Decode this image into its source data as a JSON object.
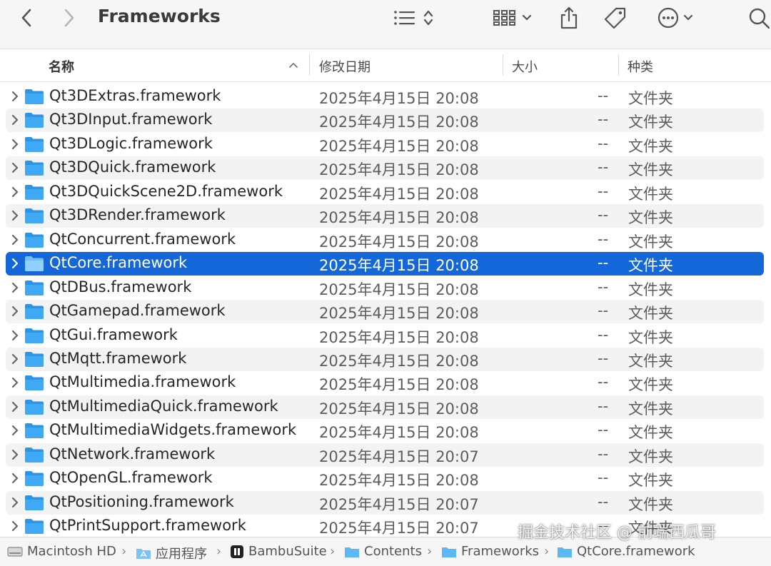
{
  "toolbar": {
    "title": "Frameworks",
    "back_icon": "chevron-left-icon",
    "forward_icon": "chevron-right-icon",
    "view_icon": "list-view-icon",
    "group_icon": "grid-group-icon",
    "share_icon": "share-icon",
    "tag_icon": "tag-icon",
    "more_icon": "ellipsis-circle-icon",
    "search_icon": "search-icon"
  },
  "columns": {
    "name": "名称",
    "modified": "修改日期",
    "size": "大小",
    "kind": "种类"
  },
  "colors": {
    "selection": "#1467d8",
    "folder": "#3fa9f5",
    "alt_row": "#f3f3f3"
  },
  "rows": [
    {
      "name": "Qt3DExtras.framework",
      "date": "2025年4月15日 20:08",
      "size": "--",
      "kind": "文件夹"
    },
    {
      "name": "Qt3DInput.framework",
      "date": "2025年4月15日 20:08",
      "size": "--",
      "kind": "文件夹"
    },
    {
      "name": "Qt3DLogic.framework",
      "date": "2025年4月15日 20:08",
      "size": "--",
      "kind": "文件夹"
    },
    {
      "name": "Qt3DQuick.framework",
      "date": "2025年4月15日 20:08",
      "size": "--",
      "kind": "文件夹"
    },
    {
      "name": "Qt3DQuickScene2D.framework",
      "date": "2025年4月15日 20:08",
      "size": "--",
      "kind": "文件夹"
    },
    {
      "name": "Qt3DRender.framework",
      "date": "2025年4月15日 20:08",
      "size": "--",
      "kind": "文件夹"
    },
    {
      "name": "QtConcurrent.framework",
      "date": "2025年4月15日 20:08",
      "size": "--",
      "kind": "文件夹"
    },
    {
      "name": "QtCore.framework",
      "date": "2025年4月15日 20:08",
      "size": "--",
      "kind": "文件夹",
      "selected": true
    },
    {
      "name": "QtDBus.framework",
      "date": "2025年4月15日 20:08",
      "size": "--",
      "kind": "文件夹"
    },
    {
      "name": "QtGamepad.framework",
      "date": "2025年4月15日 20:08",
      "size": "--",
      "kind": "文件夹"
    },
    {
      "name": "QtGui.framework",
      "date": "2025年4月15日 20:08",
      "size": "--",
      "kind": "文件夹"
    },
    {
      "name": "QtMqtt.framework",
      "date": "2025年4月15日 20:08",
      "size": "--",
      "kind": "文件夹"
    },
    {
      "name": "QtMultimedia.framework",
      "date": "2025年4月15日 20:08",
      "size": "--",
      "kind": "文件夹"
    },
    {
      "name": "QtMultimediaQuick.framework",
      "date": "2025年4月15日 20:08",
      "size": "--",
      "kind": "文件夹"
    },
    {
      "name": "QtMultimediaWidgets.framework",
      "date": "2025年4月15日 20:08",
      "size": "--",
      "kind": "文件夹"
    },
    {
      "name": "QtNetwork.framework",
      "date": "2025年4月15日 20:07",
      "size": "--",
      "kind": "文件夹"
    },
    {
      "name": "QtOpenGL.framework",
      "date": "2025年4月15日 20:08",
      "size": "--",
      "kind": "文件夹"
    },
    {
      "name": "QtPositioning.framework",
      "date": "2025年4月15日 20:07",
      "size": "--",
      "kind": "文件夹"
    },
    {
      "name": "QtPrintSupport.framework",
      "date": "2025年4月15日 20:07",
      "size": "--",
      "kind": "文件夹"
    }
  ],
  "pathbar": {
    "items": [
      "Macintosh HD",
      "应用程序",
      "BambuSuite",
      "Contents",
      "Frameworks",
      "QtCore.framework"
    ],
    "separator": "›"
  },
  "watermark": "掘金技术社区 @ 前端西瓜哥"
}
